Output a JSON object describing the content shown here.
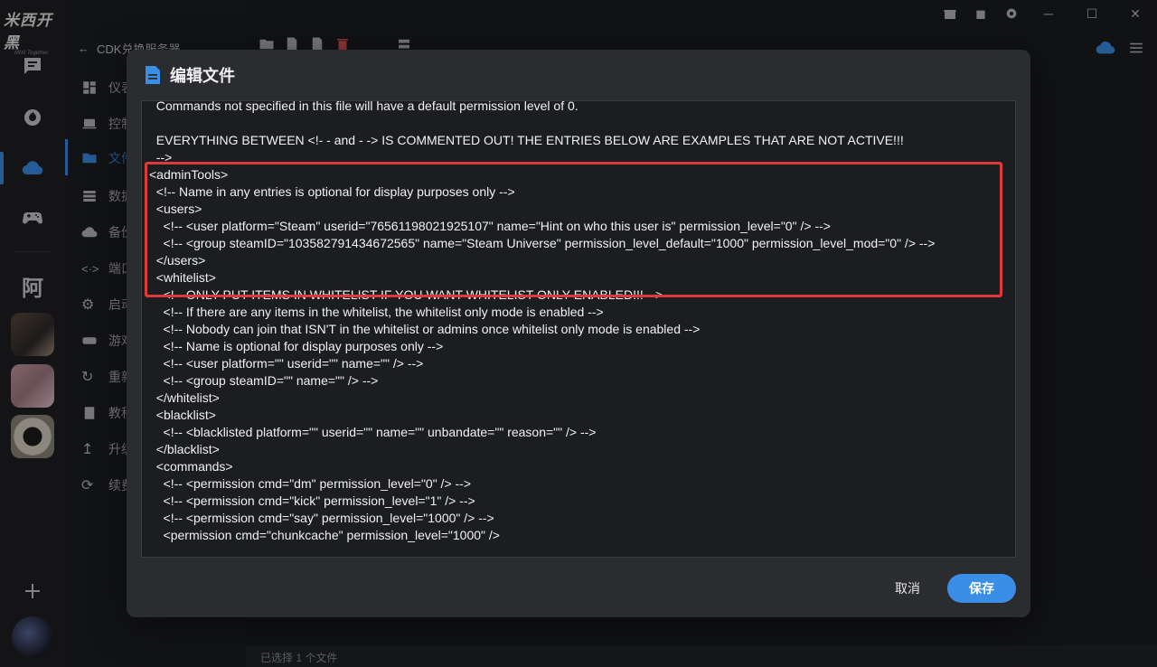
{
  "app": {
    "logo_text": "米西开黑",
    "logo_subtitle": "MIXI Together"
  },
  "rail": {
    "text_avatar": "阿"
  },
  "sidebar": {
    "back_label": "CDK兑换服务器",
    "items": [
      {
        "label": "仪表",
        "icon": "dashboard-icon"
      },
      {
        "label": "控制",
        "icon": "laptop-icon"
      },
      {
        "label": "文件",
        "icon": "folder-icon"
      },
      {
        "label": "数据",
        "icon": "database-icon"
      },
      {
        "label": "备份",
        "icon": "cloud-upload-icon"
      },
      {
        "label": "端口",
        "icon": "port-icon"
      },
      {
        "label": "启动",
        "icon": "gear-icon"
      },
      {
        "label": "游戏",
        "icon": "gamepad-icon"
      },
      {
        "label": "重新",
        "icon": "refresh-icon"
      },
      {
        "label": "教程",
        "icon": "book-icon"
      },
      {
        "label": "升级",
        "icon": "upload-icon"
      },
      {
        "label": "续费",
        "icon": "renew-icon"
      }
    ]
  },
  "status_bar": {
    "text": "已选择 1 个文件"
  },
  "modal": {
    "title": "编辑文件",
    "lines": [
      "  Commands not specified in this file will have a default permission level of 0.",
      "",
      "  EVERYTHING BETWEEN <!- - and - -> IS COMMENTED OUT! THE ENTRIES BELOW ARE EXAMPLES THAT ARE NOT ACTIVE!!!",
      "  -->",
      "<adminTools>",
      "  <!-- Name in any entries is optional for display purposes only -->",
      "  <users>",
      "    <!-- <user platform=\"Steam\" userid=\"76561198021925107\" name=\"Hint on who this user is\" permission_level=\"0\" /> -->",
      "    <!-- <group steamID=\"103582791434672565\" name=\"Steam Universe\" permission_level_default=\"1000\" permission_level_mod=\"0\" /> -->",
      "  </users>",
      "  <whitelist>",
      "    <!-- ONLY PUT ITEMS IN WHITELIST IF YOU WANT WHITELIST ONLY ENABLED!!! -->",
      "    <!-- If there are any items in the whitelist, the whitelist only mode is enabled -->",
      "    <!-- Nobody can join that ISN'T in the whitelist or admins once whitelist only mode is enabled -->",
      "    <!-- Name is optional for display purposes only -->",
      "    <!-- <user platform=\"\" userid=\"\" name=\"\" /> -->",
      "    <!-- <group steamID=\"\" name=\"\" /> -->",
      "  </whitelist>",
      "  <blacklist>",
      "    <!-- <blacklisted platform=\"\" userid=\"\" name=\"\" unbandate=\"\" reason=\"\" /> -->",
      "  </blacklist>",
      "  <commands>",
      "    <!-- <permission cmd=\"dm\" permission_level=\"0\" /> -->",
      "    <!-- <permission cmd=\"kick\" permission_level=\"1\" /> -->",
      "    <!-- <permission cmd=\"say\" permission_level=\"1000\" /> -->",
      "    <permission cmd=\"chunkcache\" permission_level=\"1000\" />"
    ],
    "cancel_label": "取消",
    "save_label": "保存"
  },
  "colors": {
    "accent": "#3a8ee6",
    "highlight_border": "#e0393b",
    "delete_red": "#e05252"
  }
}
